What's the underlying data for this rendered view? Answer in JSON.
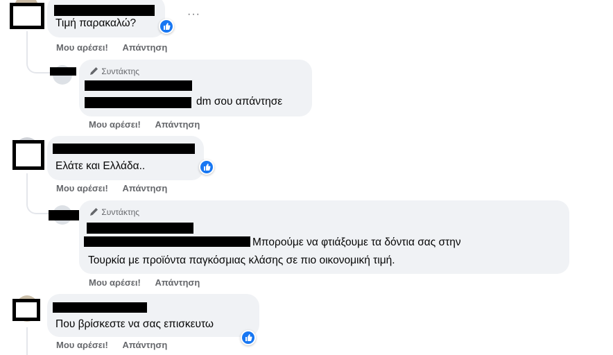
{
  "comments": [
    {
      "text": "Τιμή παρακαλώ?",
      "actions": {
        "like": "Μου αρέσει!",
        "reply": "Απάντηση"
      }
    },
    {
      "text": "Ελάτε και Ελλάδα..",
      "actions": {
        "like": "Μου αρέσει!",
        "reply": "Απάντηση"
      }
    },
    {
      "text": "Που βρίσκεστε να σας επισκευτω",
      "actions": {
        "like": "Μου αρέσει!",
        "reply": "Απάντηση"
      }
    }
  ],
  "replies": [
    {
      "author_badge": "Συντάκτης",
      "text": "dm σου απάντησε",
      "actions": {
        "like": "Μου αρέσει!",
        "reply": "Απάντηση"
      }
    },
    {
      "author_badge": "Συντάκτης",
      "text_line1": "Μπορούμε να φτιάξουμε τα δόντια σας στην",
      "text_line2": "Τουρκία με προϊόντα παγκόσμιας κλάσης σε πιο οικονομική τιμή.",
      "actions": {
        "like": "Μου αρέσει!",
        "reply": "Απάντηση"
      }
    }
  ],
  "more_menu": "···",
  "icons": {
    "like": "thumbs-up-icon",
    "editor": "pencil-icon",
    "more": "more-options-icon"
  },
  "colors": {
    "like_blue": "#1877f2",
    "bubble": "#f0f2f5",
    "meta_gray": "#65676b"
  }
}
